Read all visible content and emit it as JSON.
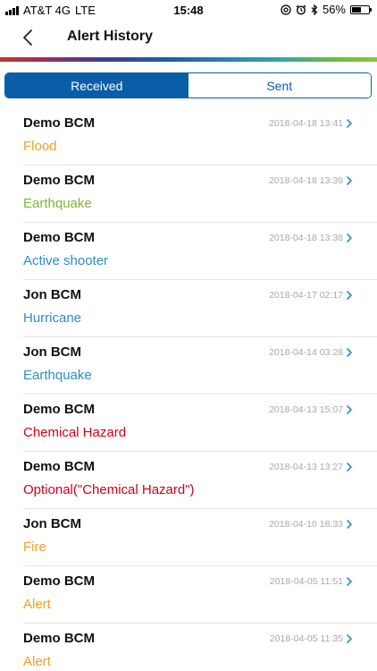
{
  "status_bar": {
    "carrier": "AT&T 4G",
    "network": "LTE",
    "time": "15:48",
    "battery_percent": "56%",
    "battery_level": 0.56,
    "icons": [
      "signal-icon",
      "at-icon",
      "alarm-icon",
      "bluetooth-icon",
      "battery-icon"
    ]
  },
  "nav": {
    "title": "Alert History",
    "back_icon": "chevron-left-icon"
  },
  "tabs": [
    {
      "label": "Received",
      "active": true
    },
    {
      "label": "Sent",
      "active": false
    }
  ],
  "colors": {
    "accent": "#0a5ea8",
    "orange": "#f0a021",
    "green": "#7cb82f",
    "blue": "#2a8fc4",
    "red": "#d0021b",
    "timestamp": "#a8a8a8"
  },
  "alerts": [
    {
      "sender": "Demo BCM",
      "type": "Flood",
      "time": "2018-04-18 13:41",
      "color": "#f0a021"
    },
    {
      "sender": "Demo BCM",
      "type": "Earthquake",
      "time": "2018-04-18 13:39",
      "color": "#7cb82f"
    },
    {
      "sender": "Demo BCM",
      "type": "Active shooter",
      "time": "2018-04-18 13:38",
      "color": "#2a8fc4"
    },
    {
      "sender": "Jon BCM",
      "type": "Hurricane",
      "time": "2018-04-17 02:17",
      "color": "#2a8fc4"
    },
    {
      "sender": "Jon BCM",
      "type": "Earthquake",
      "time": "2018-04-14 03:28",
      "color": "#2a8fc4"
    },
    {
      "sender": "Demo BCM",
      "type": "Chemical Hazard",
      "time": "2018-04-13 15:07",
      "color": "#d0021b"
    },
    {
      "sender": "Demo BCM",
      "type": "Optional(\"Chemical Hazard\")",
      "time": "2018-04-13 13:27",
      "color": "#d0021b"
    },
    {
      "sender": "Jon BCM",
      "type": "Fire",
      "time": "2018-04-10 18:33",
      "color": "#f0a021"
    },
    {
      "sender": "Demo BCM",
      "type": "Alert",
      "time": "2018-04-05 11:51",
      "color": "#f0a021"
    },
    {
      "sender": "Demo BCM",
      "type": "Alert",
      "time": "2018-04-05 11:35",
      "color": "#f0a021"
    }
  ]
}
